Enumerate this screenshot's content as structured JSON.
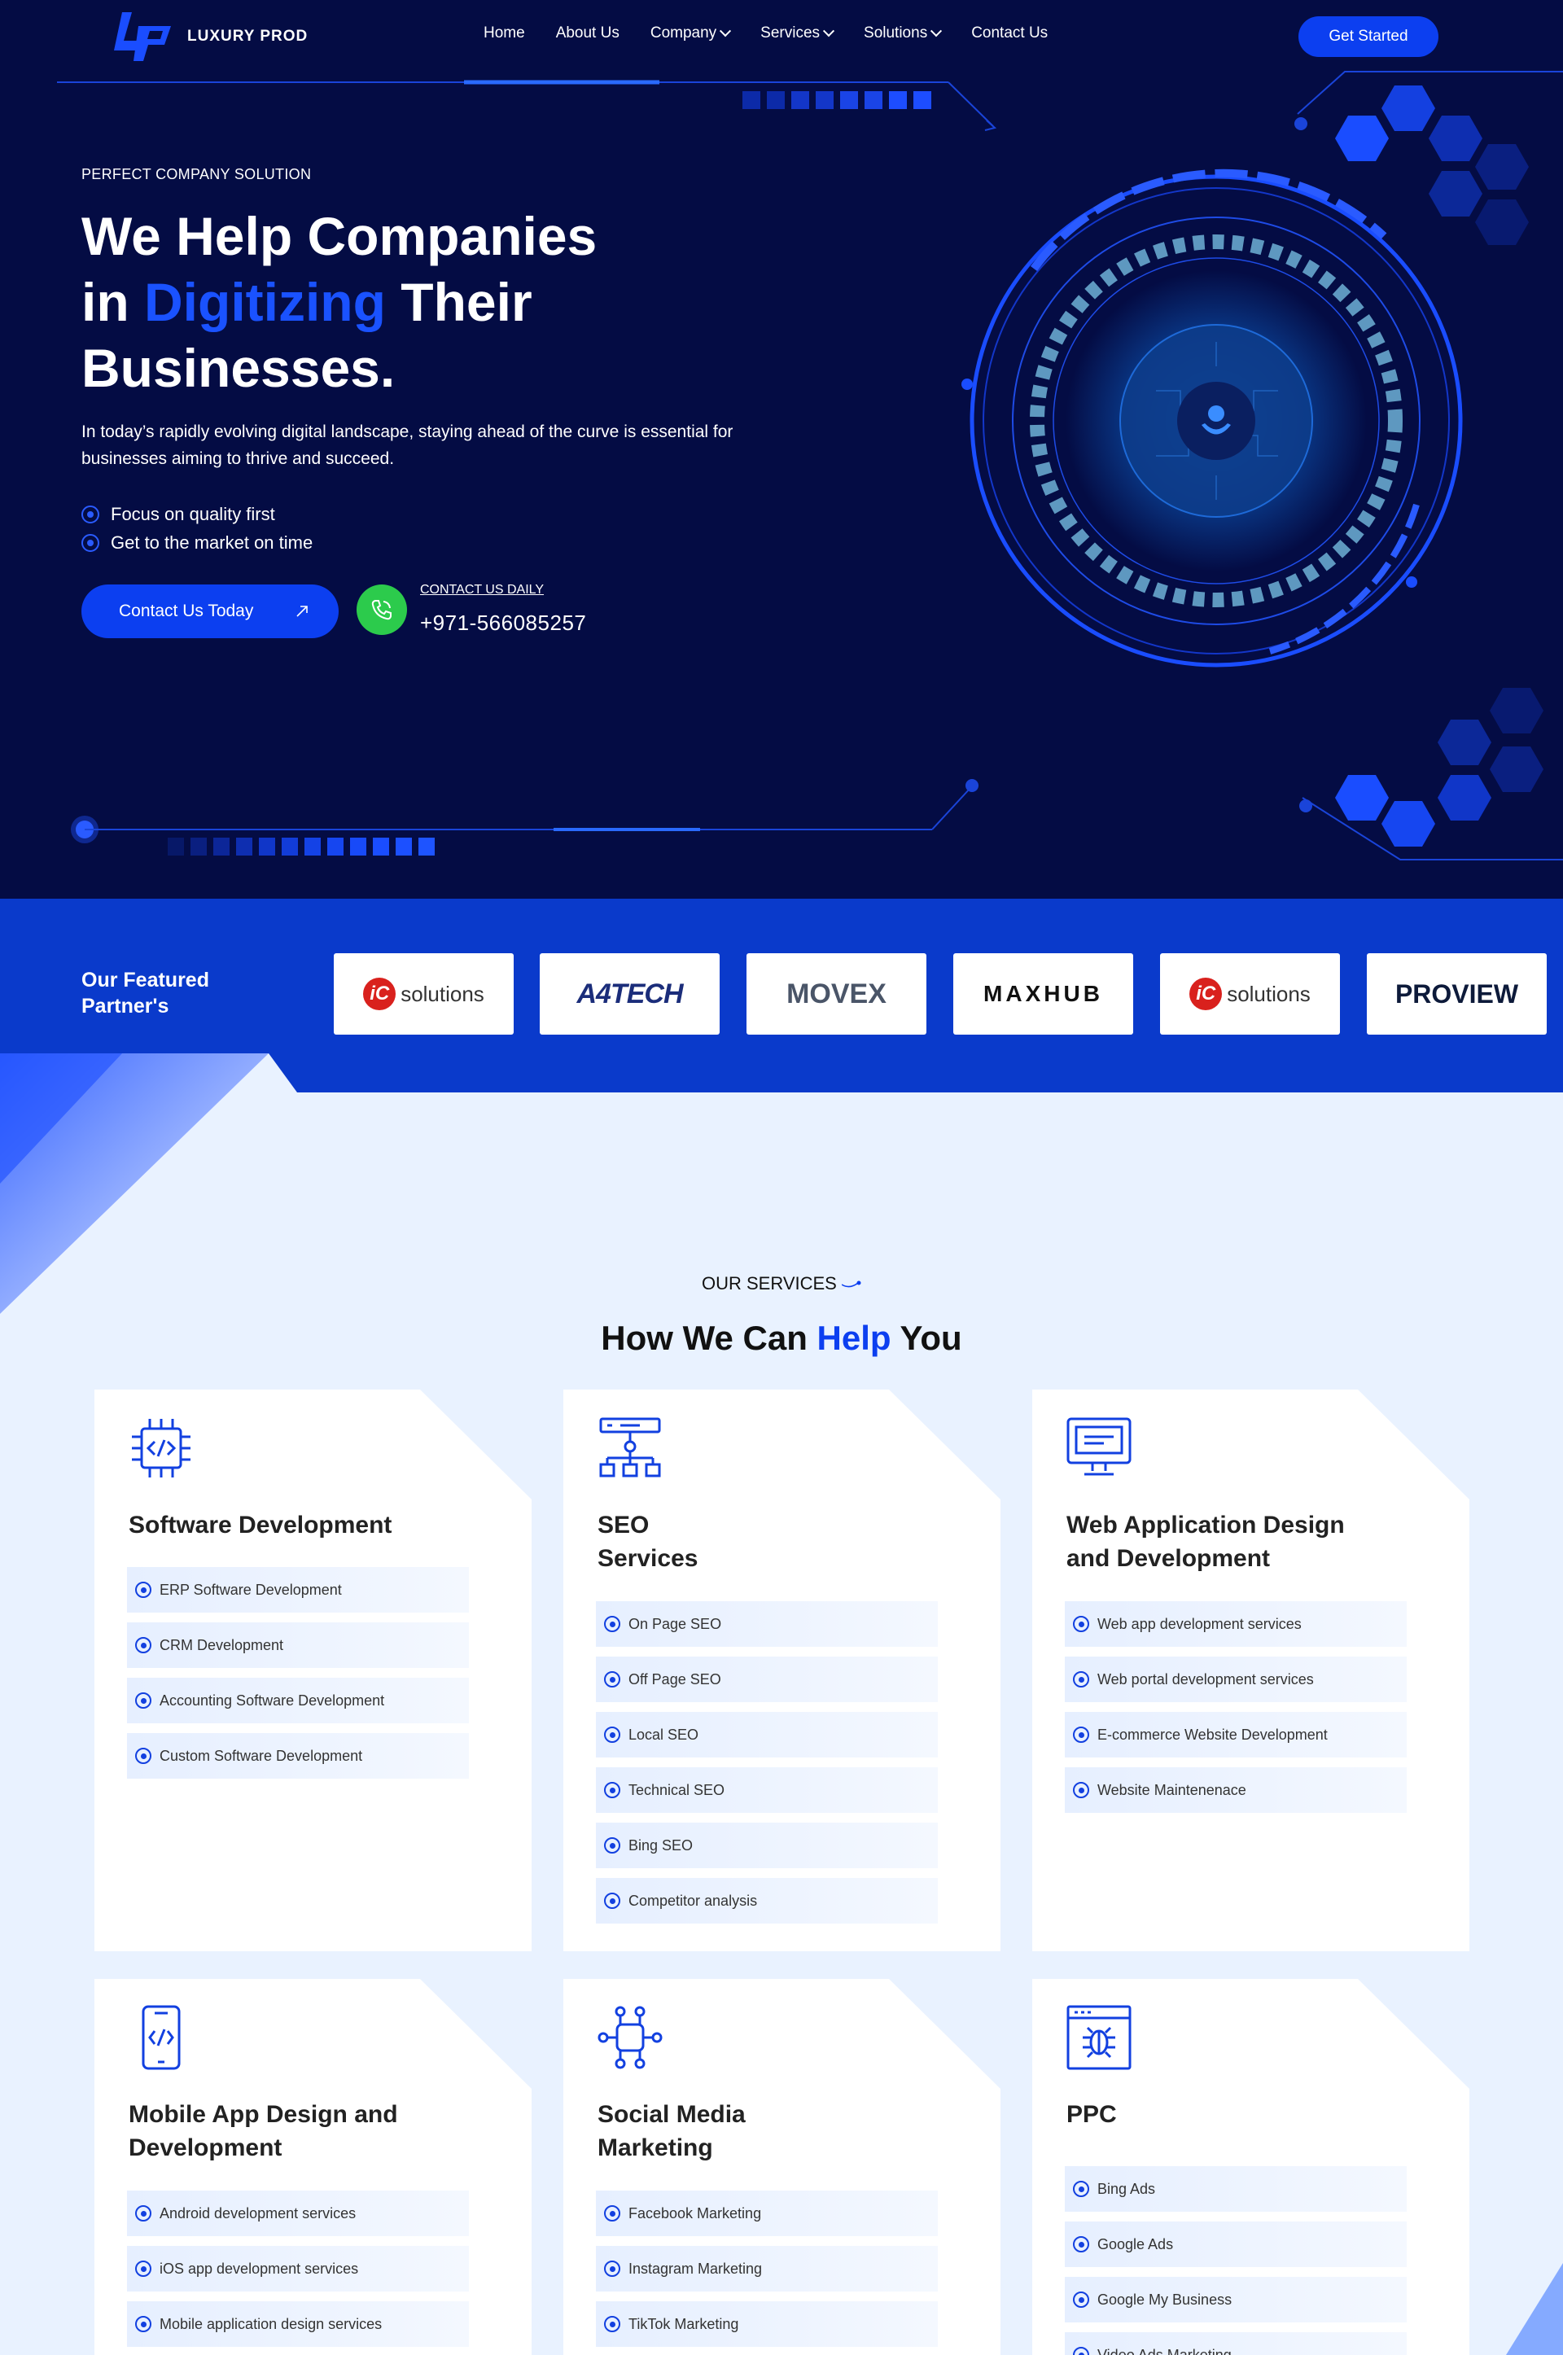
{
  "brand": {
    "name": "LUXURY PROD",
    "accent": "#0c3ff0",
    "hero_bg": "#040c44",
    "partners_bg": "#0a3acb"
  },
  "nav": {
    "items": [
      {
        "label": "Home",
        "has_dropdown": false
      },
      {
        "label": "About Us",
        "has_dropdown": false
      },
      {
        "label": "Company",
        "has_dropdown": true
      },
      {
        "label": "Services",
        "has_dropdown": true
      },
      {
        "label": "Solutions",
        "has_dropdown": true
      },
      {
        "label": "Contact Us",
        "has_dropdown": false
      }
    ],
    "cta": "Get Started"
  },
  "hero": {
    "eyebrow": "PERFECT COMPANY SOLUTION",
    "title_l1": "We Help Companies",
    "title_l2_pre": "in ",
    "title_l2_hl": "Digitizing",
    "title_l2_post": " Their",
    "title_l3": "Businesses.",
    "description": "In today’s rapidly evolving digital landscape, staying ahead of the curve is essential for businesses aiming to thrive and succeed.",
    "bullets": [
      "Focus on quality first",
      "Get to the market on time"
    ],
    "button": "Contact Us Today",
    "phone_label": "CONTACT US DAILY",
    "phone": "+971-566085257"
  },
  "partners": {
    "title_l1": "Our Featured",
    "title_l2": "Partner's",
    "logos": [
      {
        "name": "iC solutions",
        "mark": "iC",
        "text": "solutions"
      },
      {
        "name": "A4TECH",
        "mark": "",
        "text": "A4TECH"
      },
      {
        "name": "MOVEX",
        "mark": "",
        "text": "MOVEX"
      },
      {
        "name": "MAXHUB",
        "mark": "",
        "text": "MAXHUB"
      },
      {
        "name": "iC solutions",
        "mark": "iC",
        "text": "solutions"
      },
      {
        "name": "PROVIEW",
        "mark": "",
        "text": "PROVIEW"
      }
    ]
  },
  "services": {
    "label": "OUR SERVICES",
    "title_pre": "How We Can ",
    "title_hl": "Help",
    "title_post": " You",
    "cards": [
      {
        "icon": "chip-code-icon",
        "title_l1": "Software Development",
        "title_l2": "",
        "items": [
          "ERP Software Development",
          "CRM Development",
          "Accounting Software Development",
          "Custom Software Development"
        ]
      },
      {
        "icon": "sitemap-icon",
        "title_l1": "SEO",
        "title_l2": "Services",
        "items": [
          "On Page SEO",
          "Off Page SEO",
          "Local SEO",
          "Technical SEO",
          "Bing SEO",
          "Competitor analysis"
        ]
      },
      {
        "icon": "monitor-icon",
        "title_l1": "Web Application Design",
        "title_l2": "and Development",
        "items": [
          "Web app development services",
          "Web portal development services",
          "E-commerce Website Development",
          "Website Maintenenace"
        ]
      },
      {
        "icon": "mobile-code-icon",
        "title_l1": "Mobile App Design and",
        "title_l2": "Development",
        "items": [
          "Android development services",
          "iOS app development services",
          "Mobile application design services"
        ]
      },
      {
        "icon": "network-icon",
        "title_l1": "Social Media",
        "title_l2": "Marketing",
        "items": [
          "Facebook Marketing",
          "Instagram Marketing",
          "TikTok Marketing"
        ]
      },
      {
        "icon": "browser-bug-icon",
        "title_l1": "PPC",
        "title_l2": "",
        "items": [
          "Bing Ads",
          "Google Ads",
          "Google My Business",
          "Video Ads Marketing"
        ]
      }
    ]
  }
}
